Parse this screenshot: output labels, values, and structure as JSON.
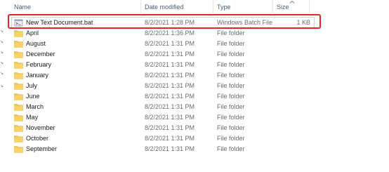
{
  "columns": {
    "name": "Name",
    "date_modified": "Date modified",
    "type": "Type",
    "size": "Size"
  },
  "rows": [
    {
      "name": "New Text Document.bat",
      "date": "8/2/2021 1:28 PM",
      "type": "Windows Batch File",
      "size": "1 KB",
      "icon": "batch-file-icon"
    },
    {
      "name": "April",
      "date": "8/2/2021 1:36 PM",
      "type": "File folder",
      "size": "",
      "icon": "folder-icon"
    },
    {
      "name": "August",
      "date": "8/2/2021 1:31 PM",
      "type": "File folder",
      "size": "",
      "icon": "folder-icon"
    },
    {
      "name": "December",
      "date": "8/2/2021 1:31 PM",
      "type": "File folder",
      "size": "",
      "icon": "folder-icon"
    },
    {
      "name": "February",
      "date": "8/2/2021 1:31 PM",
      "type": "File folder",
      "size": "",
      "icon": "folder-icon"
    },
    {
      "name": "January",
      "date": "8/2/2021 1:31 PM",
      "type": "File folder",
      "size": "",
      "icon": "folder-icon"
    },
    {
      "name": "July",
      "date": "8/2/2021 1:31 PM",
      "type": "File folder",
      "size": "",
      "icon": "folder-icon"
    },
    {
      "name": "June",
      "date": "8/2/2021 1:31 PM",
      "type": "File folder",
      "size": "",
      "icon": "folder-icon"
    },
    {
      "name": "March",
      "date": "8/2/2021 1:31 PM",
      "type": "File folder",
      "size": "",
      "icon": "folder-icon"
    },
    {
      "name": "May",
      "date": "8/2/2021 1:31 PM",
      "type": "File folder",
      "size": "",
      "icon": "folder-icon"
    },
    {
      "name": "November",
      "date": "8/2/2021 1:31 PM",
      "type": "File folder",
      "size": "",
      "icon": "folder-icon"
    },
    {
      "name": "October",
      "date": "8/2/2021 1:31 PM",
      "type": "File folder",
      "size": "",
      "icon": "folder-icon"
    },
    {
      "name": "September",
      "date": "8/2/2021 1:31 PM",
      "type": "File folder",
      "size": "",
      "icon": "folder-icon"
    }
  ],
  "colors": {
    "highlight": "#e3262b",
    "folder": "#f3c44f",
    "header_text": "#4c607a"
  }
}
